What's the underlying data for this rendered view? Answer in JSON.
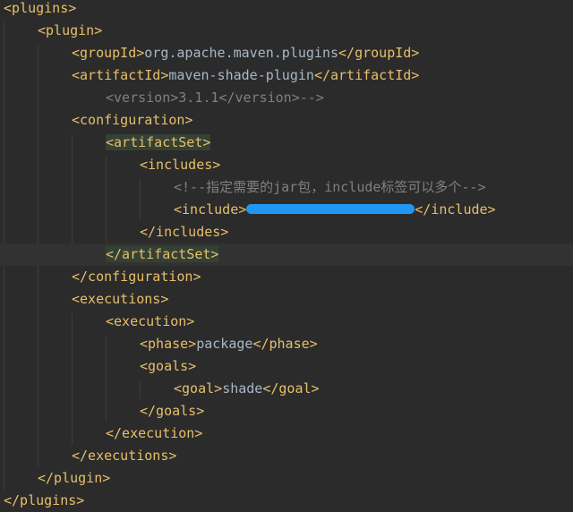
{
  "code": {
    "l1": "<plugins>",
    "l2": "<plugin>",
    "l3_open": "<groupId>",
    "l3_text": "org.apache.maven.plugins",
    "l3_close": "</groupId>",
    "l4_open": "<artifactId>",
    "l4_text": "maven-shade-plugin",
    "l4_close": "</artifactId>",
    "l5_comment": "<version>3.1.1</version>-->",
    "l6": "<configuration>",
    "l7": "<artifactSet>",
    "l8": "<includes>",
    "l9_comment": "<!--指定需要的jar包，include标签可以多个-->",
    "l10_open": "<include>",
    "l10_close": "</include>",
    "l11": "</includes>",
    "l12": "</artifactSet>",
    "l13": "</configuration>",
    "l14": "<executions>",
    "l15": "<execution>",
    "l16_open": "<phase>",
    "l16_text": "package",
    "l16_close": "</phase>",
    "l17": "<goals>",
    "l18_open": "<goal>",
    "l18_text": "shade",
    "l18_close": "</goal>",
    "l19": "</goals>",
    "l20": "</execution>",
    "l21": "</executions>",
    "l22": "</plugin>",
    "l23": "</plugins>"
  },
  "colors": {
    "background": "#2b2b2b",
    "tag": "#e8bf6a",
    "text": "#a9b7c6",
    "comment": "#808080",
    "tag_highlight": "#344134",
    "redaction": "#2196f3"
  }
}
